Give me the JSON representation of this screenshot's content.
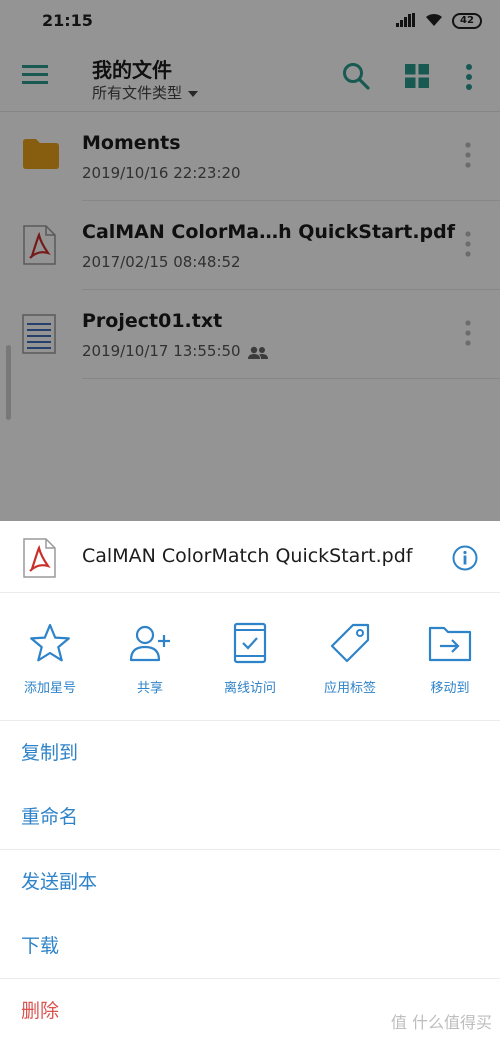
{
  "status": {
    "time": "21:15",
    "battery": "42"
  },
  "appbar": {
    "title": "我的文件",
    "filter": "所有文件类型"
  },
  "files": [
    {
      "name": "Moments",
      "date": "2019/10/16 22:23:20",
      "type": "folder"
    },
    {
      "name": "CalMAN ColorMa…h QuickStart.pdf",
      "date": "2017/02/15 08:48:52",
      "type": "pdf"
    },
    {
      "name": "Project01.txt",
      "date": "2019/10/17 13:55:50",
      "type": "text",
      "shared": true
    }
  ],
  "sheet": {
    "file_name": "CalMAN ColorMatch QuickStart.pdf",
    "actions": [
      {
        "label": "添加星号",
        "icon": "star-icon"
      },
      {
        "label": "共享",
        "icon": "add-person-icon"
      },
      {
        "label": "离线访问",
        "icon": "offline-device-icon"
      },
      {
        "label": "应用标签",
        "icon": "tag-icon"
      },
      {
        "label": "移动到",
        "icon": "move-folder-icon"
      }
    ],
    "menu": [
      {
        "label": "复制到"
      },
      {
        "label": "重命名"
      },
      {
        "label": "发送副本"
      },
      {
        "label": "下载"
      },
      {
        "label": "删除"
      }
    ]
  },
  "watermark": "值 什么值得买",
  "colors": {
    "accent": "#2f83c8",
    "danger": "#d9534f",
    "folder": "#e9a21a",
    "pdf": "#c9302c"
  }
}
